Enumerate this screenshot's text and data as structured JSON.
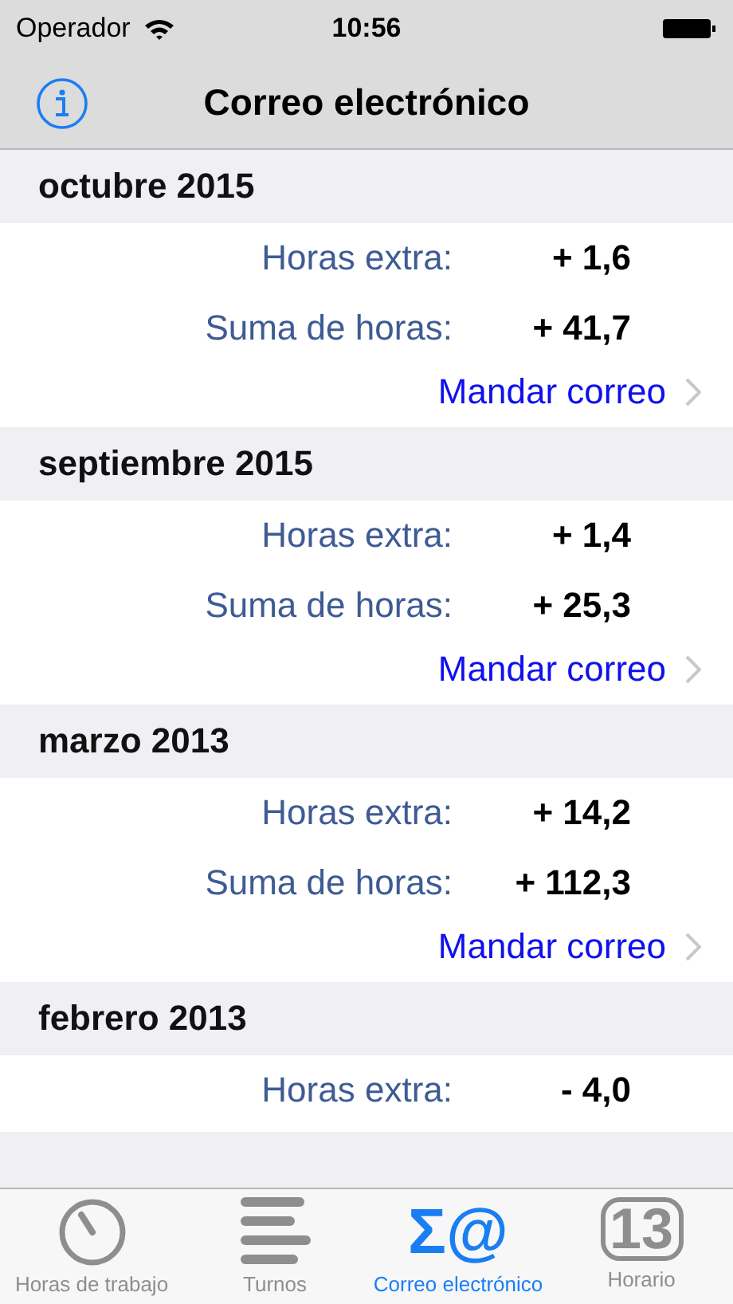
{
  "status_bar": {
    "carrier": "Operador",
    "time": "10:56"
  },
  "nav_bar": {
    "title": "Correo electrónico"
  },
  "sections": [
    {
      "title": "octubre 2015",
      "rows": [
        {
          "label": "Horas extra:",
          "value": "+ 1,6"
        },
        {
          "label": "Suma de horas:",
          "value": "+ 41,7"
        }
      ],
      "link": "Mandar correo"
    },
    {
      "title": "septiembre 2015",
      "rows": [
        {
          "label": "Horas extra:",
          "value": "+ 1,4"
        },
        {
          "label": "Suma de horas:",
          "value": "+ 25,3"
        }
      ],
      "link": "Mandar correo"
    },
    {
      "title": "marzo 2013",
      "rows": [
        {
          "label": "Horas extra:",
          "value": "+ 14,2"
        },
        {
          "label": "Suma de horas:",
          "value": "+ 112,3"
        }
      ],
      "link": "Mandar correo"
    },
    {
      "title": "febrero 2013",
      "rows": [
        {
          "label": "Horas extra:",
          "value": "- 4,0"
        }
      ]
    }
  ],
  "tab_bar": [
    {
      "kind": "clock",
      "label": "Horas de trabajo",
      "selected": false
    },
    {
      "kind": "lines",
      "label": "Turnos",
      "selected": false
    },
    {
      "kind": "glyph",
      "glyph": "Σ@",
      "label": "Correo electrónico",
      "selected": true
    },
    {
      "kind": "badge",
      "glyph": "13",
      "label": "Horario",
      "selected": false
    }
  ]
}
